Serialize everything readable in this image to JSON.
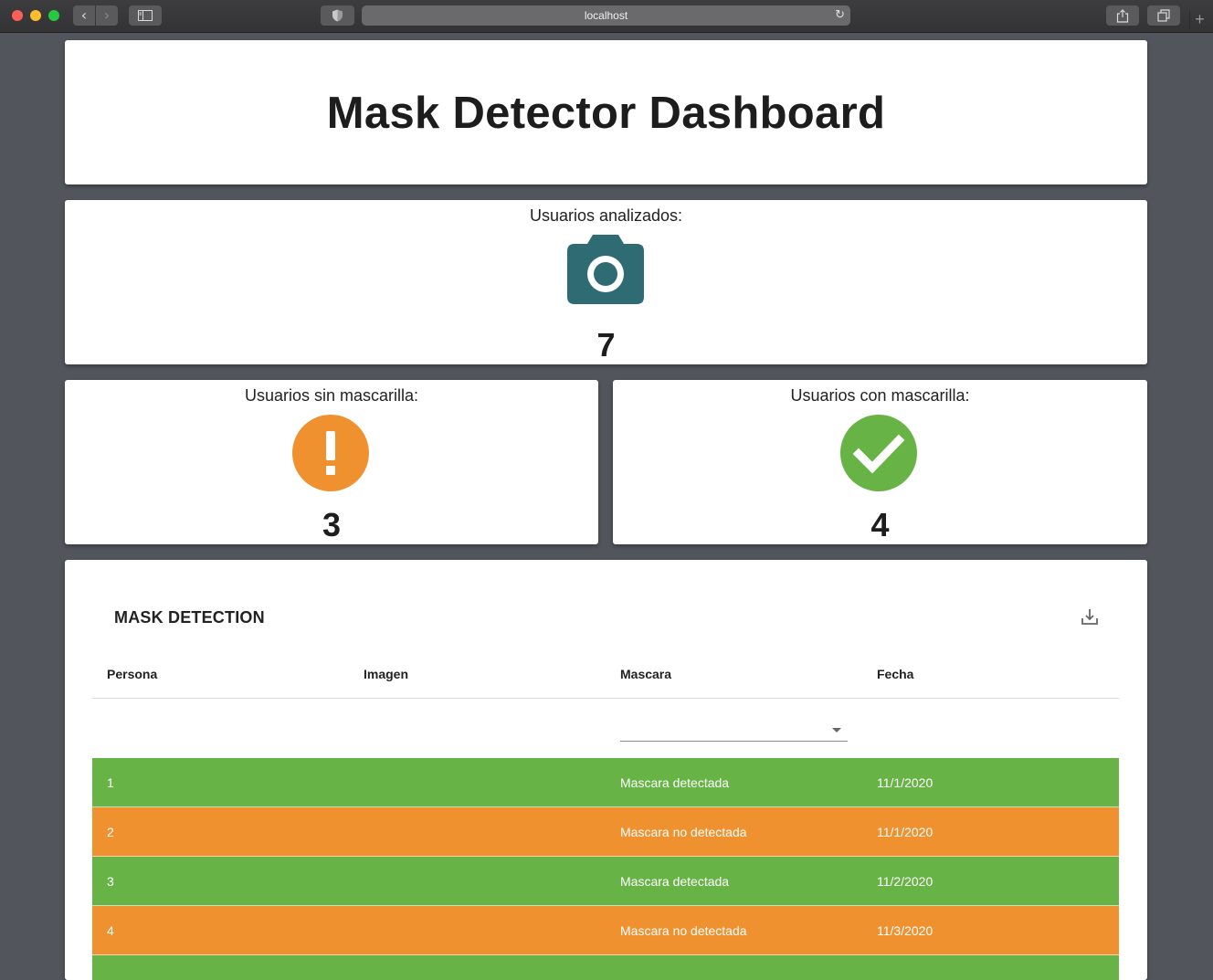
{
  "browser": {
    "url": "localhost"
  },
  "header": {
    "title": "Mask Detector Dashboard"
  },
  "stats": {
    "analyzed": {
      "label": "Usuarios analizados:",
      "value": "7",
      "icon": "camera-icon",
      "color": "#2e6b73"
    },
    "without_mask": {
      "label": "Usuarios sin mascarilla:",
      "value": "3",
      "icon": "exclamation-icon",
      "color": "#f0912f"
    },
    "with_mask": {
      "label": "Usuarios con mascarilla:",
      "value": "4",
      "icon": "check-icon",
      "color": "#67b346"
    }
  },
  "table": {
    "title": "MASK DETECTION",
    "download_icon": "download-icon",
    "columns": [
      "Persona",
      "Imagen",
      "Mascara",
      "Fecha"
    ],
    "filter": {
      "mascara_selected": ""
    },
    "status_colors": {
      "detected": "#67b346",
      "not_detected": "#f0912f"
    },
    "rows": [
      {
        "persona": "1",
        "imagen": "",
        "mascara": "Mascara detectada",
        "fecha": "11/1/2020",
        "status": "detected"
      },
      {
        "persona": "2",
        "imagen": "",
        "mascara": "Mascara no detectada",
        "fecha": "11/1/2020",
        "status": "not_detected"
      },
      {
        "persona": "3",
        "imagen": "",
        "mascara": "Mascara detectada",
        "fecha": "11/2/2020",
        "status": "detected"
      },
      {
        "persona": "4",
        "imagen": "",
        "mascara": "Mascara no detectada",
        "fecha": "11/3/2020",
        "status": "not_detected"
      },
      {
        "persona": "",
        "imagen": "",
        "mascara": "",
        "fecha": "",
        "status": "detected"
      }
    ]
  }
}
